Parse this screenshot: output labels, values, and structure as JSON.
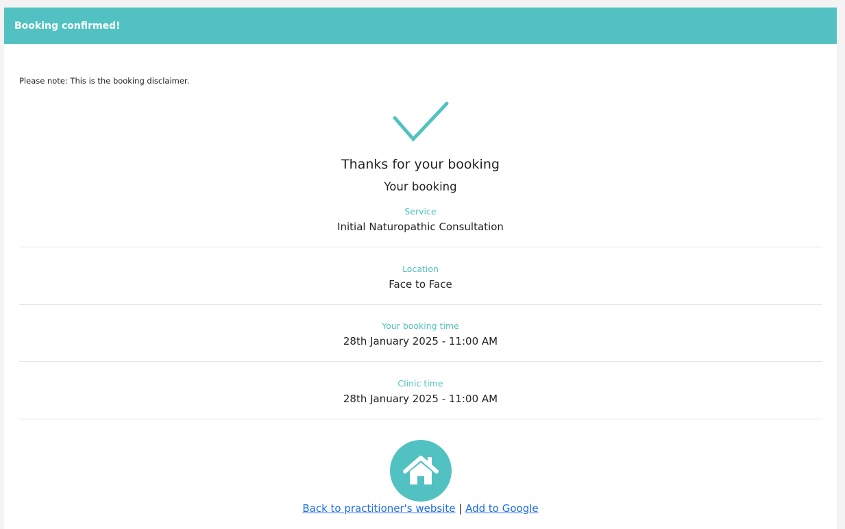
{
  "header": {
    "title": "Booking confirmed!"
  },
  "disclaimer": "Please note: This is the booking disclaimer.",
  "confirmation": {
    "thanks": "Thanks for your booking",
    "subtitle": "Your booking",
    "icon": "check-icon"
  },
  "details": [
    {
      "label": "Service",
      "value": "Initial Naturopathic Consultation"
    },
    {
      "label": "Location",
      "value": "Face to Face"
    },
    {
      "label": "Your booking time",
      "value": "28th January 2025 - 11:00 AM"
    },
    {
      "label": "Clinic time",
      "value": "28th January 2025 - 11:00 AM"
    }
  ],
  "footer": {
    "home_icon": "home-icon",
    "back_link": "Back to practitioner's website",
    "separator": "|",
    "google_link": "Add to Google"
  },
  "colors": {
    "accent": "#52c1c2",
    "link": "#1a6ce8"
  }
}
